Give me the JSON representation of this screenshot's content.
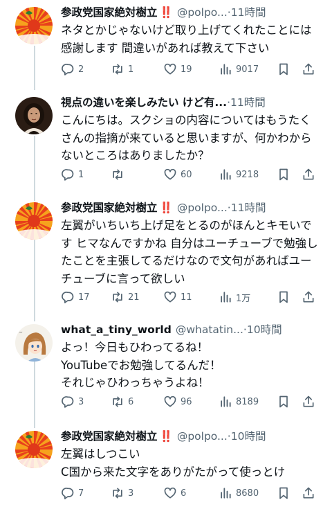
{
  "tweets": [
    {
      "name": "参政党国家絶対樹立",
      "bang": "‼️",
      "handle": "@polpo...",
      "dot": "·",
      "time": "11時間",
      "avatar": "rising-sun-avatar",
      "text": "ネタとかじゃないけど取り上げてくれたことには感謝します 間違いがあれば教えて下さい",
      "replies": "2",
      "retweets": "1",
      "likes": "19",
      "views": "9017"
    },
    {
      "name": "視点の違いを楽しみたい けど有...",
      "bang": "",
      "handle": "",
      "dot": "·",
      "time": "11時間",
      "avatar": "portrait-avatar",
      "text": "こんにちは。スクショの内容についてはもうたくさんの指摘が来ていると思いますが、何かわからないところはありましたか？",
      "replies": "1",
      "retweets": "",
      "likes": "60",
      "views": "9218"
    },
    {
      "name": "参政党国家絶対樹立",
      "bang": "‼️",
      "handle": "@polpo...",
      "dot": "·",
      "time": "11時間",
      "avatar": "rising-sun-avatar",
      "text": "左翼がいちいち上げ足をとるのがほんとキモいです ヒマなんですかね 自分はユーチューブで勉強したことを主張してるだけなので文句があればユーチューブに言って欲しい",
      "replies": "17",
      "retweets": "21",
      "likes": "11",
      "views": "1万"
    },
    {
      "name": "what_a_tiny_world",
      "bang": "",
      "handle": "@whatatin...",
      "dot": "·",
      "time": "10時間",
      "avatar": "anime-girl-avatar",
      "text": "よっ！今日もひわってるね！\nYouTubeでお勉強してるんだ！\nそれじゃひわっちゃうよね！",
      "replies": "3",
      "retweets": "6",
      "likes": "96",
      "views": "8189"
    },
    {
      "name": "参政党国家絶対樹立",
      "bang": "‼️",
      "handle": "@polpo...",
      "dot": "·",
      "time": "10時間",
      "avatar": "rising-sun-avatar",
      "text": "左翼はしつこい\nC国から来た文字をありがたがって使っとけ",
      "replies": "7",
      "retweets": "3",
      "likes": "6",
      "views": "8680"
    }
  ],
  "colors": {
    "secondary_text": "#536471",
    "primary_text": "#0f1419",
    "thread_line": "#cfd9de",
    "sun_red": "#e8401c",
    "sun_orange": "#f39a1e"
  }
}
